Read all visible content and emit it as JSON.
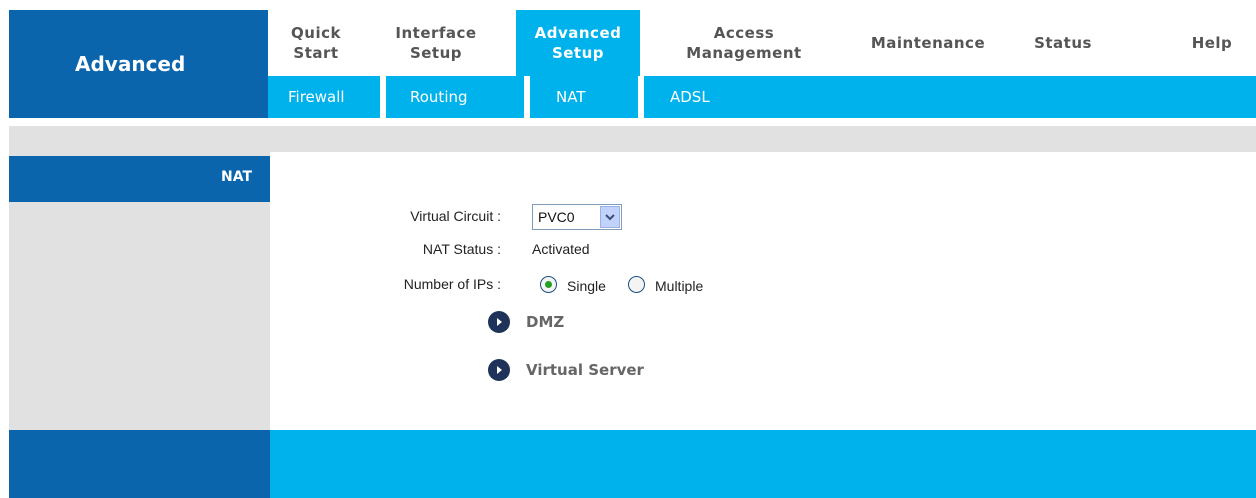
{
  "brand": {
    "title": "Advanced"
  },
  "nav": {
    "items": [
      {
        "label": "Quick\nStart"
      },
      {
        "label": "Interface\nSetup"
      },
      {
        "label": "Advanced\nSetup"
      },
      {
        "label": "Access\nManagement"
      },
      {
        "label": "Maintenance"
      },
      {
        "label": "Status"
      },
      {
        "label": "Help"
      }
    ]
  },
  "subnav": {
    "items": [
      {
        "label": "Firewall"
      },
      {
        "label": "Routing"
      },
      {
        "label": "NAT"
      },
      {
        "label": "ADSL"
      }
    ]
  },
  "side": {
    "title": "NAT"
  },
  "form": {
    "virtual_circuit_label": "Virtual Circuit :",
    "virtual_circuit_value": "PVC0",
    "nat_status_label": "NAT Status :",
    "nat_status_value": "Activated",
    "num_ips_label": "Number of IPs :",
    "option_single": "Single",
    "option_multiple": "Multiple",
    "selected_option": "Single"
  },
  "links": {
    "dmz": "DMZ",
    "virtual_server": "Virtual Server"
  },
  "colors": {
    "dark_blue": "#0b65ad",
    "light_blue": "#00b2eb",
    "gray": "#e1e1e1"
  },
  "icons": {
    "select_arrow": "chevron-down-icon",
    "link_bullet": "play-circle-icon"
  }
}
